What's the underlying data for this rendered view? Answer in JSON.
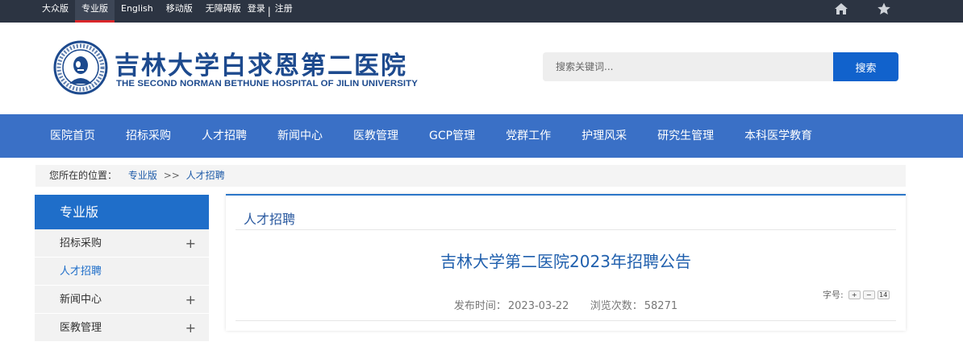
{
  "topbar": {
    "links": [
      "大众版",
      "专业版",
      "English",
      "移动版",
      "无障碍版"
    ],
    "active_index": 1,
    "login": "登录",
    "divider": "|",
    "register": "注册",
    "icons": [
      "home-icon",
      "star-icon"
    ]
  },
  "header": {
    "logo_cn": "吉林大学白求恩第二医院",
    "logo_en": "THE SECOND NORMAN BETHUNE HOSPITAL OF JILIN UNIVERSITY",
    "search": {
      "placeholder": "搜索关键词...",
      "button": "搜索"
    }
  },
  "nav": [
    "医院首页",
    "招标采购",
    "人才招聘",
    "新闻中心",
    "医教管理",
    "GCP管理",
    "党群工作",
    "护理风采",
    "研究生管理",
    "本科医学教育"
  ],
  "breadcrumb": {
    "prefix": "您所在的位置：",
    "items": [
      "专业版",
      "人才招聘"
    ],
    "separator": ">>"
  },
  "sidebar": {
    "title": "专业版",
    "items": [
      {
        "label": "招标采购",
        "expand": "+"
      },
      {
        "label": "人才招聘",
        "expand": ""
      },
      {
        "label": "新闻中心",
        "expand": "+"
      },
      {
        "label": "医教管理",
        "expand": "+"
      }
    ],
    "active_index": 1
  },
  "content": {
    "section_title": "人才招聘",
    "article_title": "吉林大学第二医院2023年招聘公告",
    "font_size_label": "字号:",
    "font_buttons": [
      "+",
      "−",
      "14"
    ],
    "publish_label": "发布时间：",
    "publish_date": "2023-03-22",
    "views_label": "浏览次数：",
    "views": "58271"
  },
  "colors": {
    "topbar": "#2c3442",
    "nav": "#3a70c6",
    "accent": "#1f6ec9",
    "search_button": "#1162cc",
    "active_underline": "#d9262a"
  }
}
